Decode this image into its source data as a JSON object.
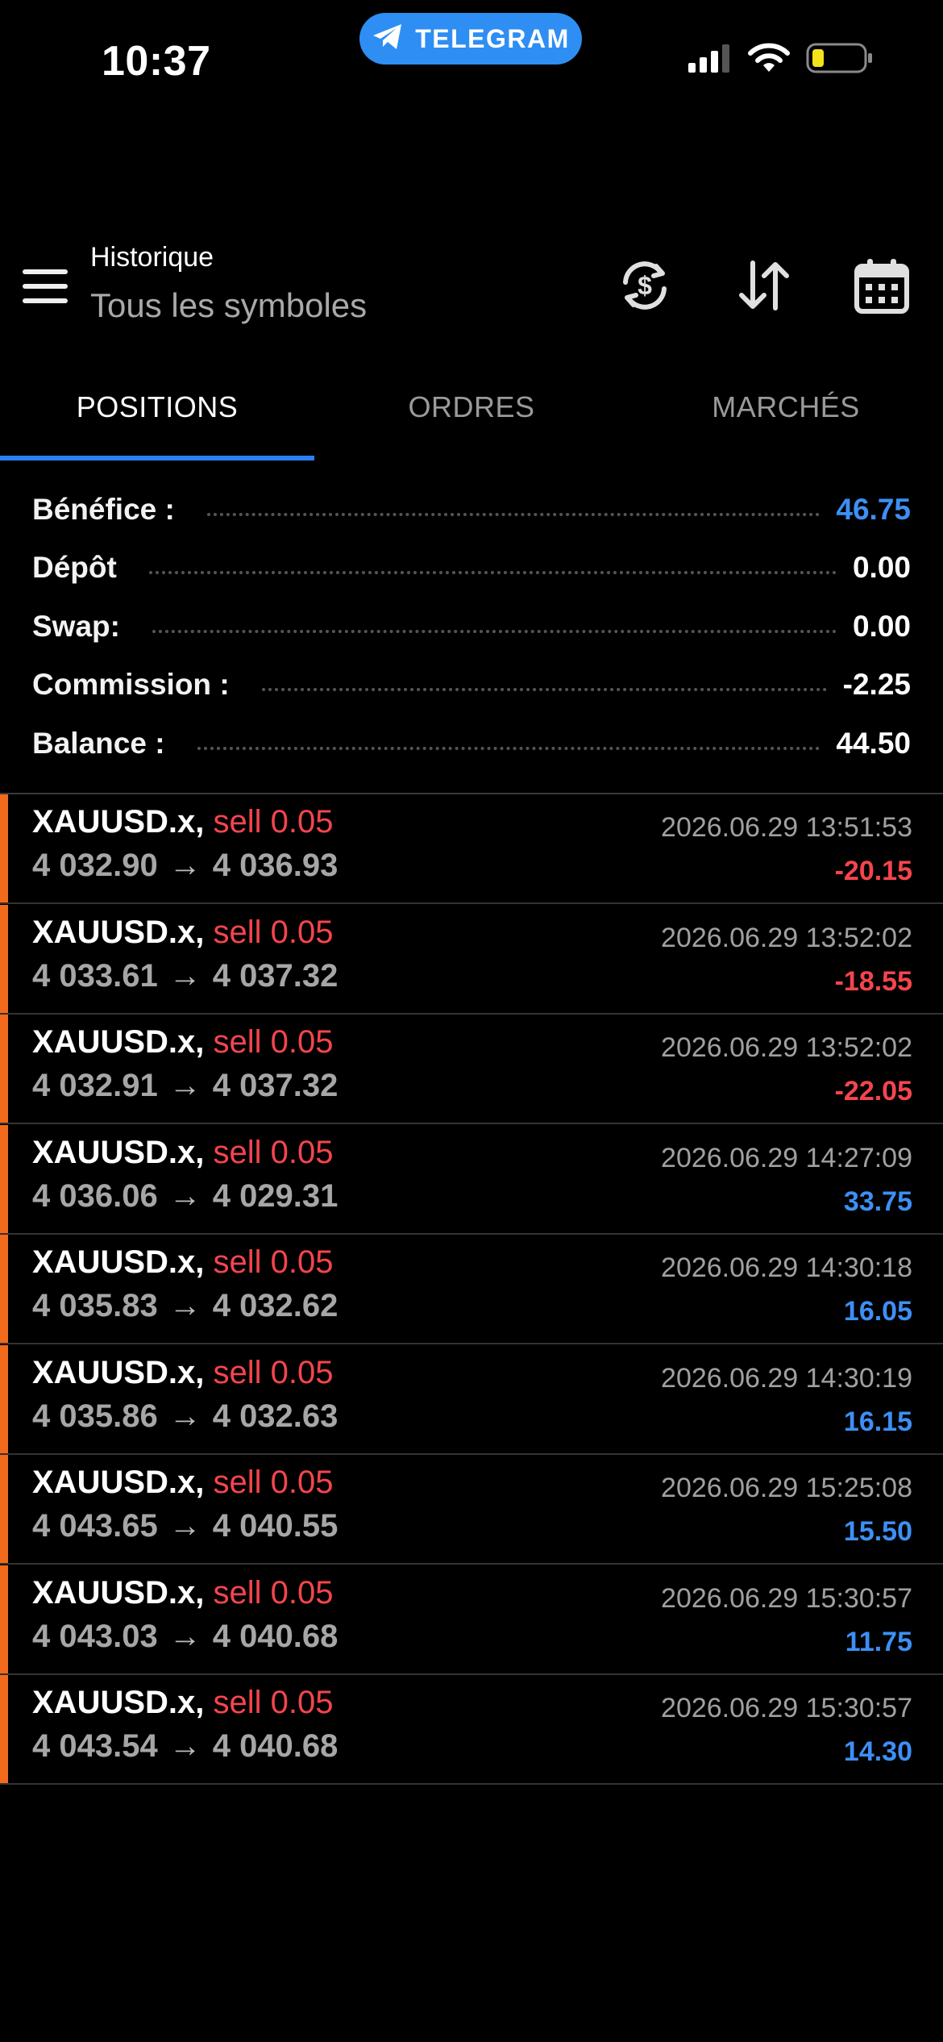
{
  "status_bar": {
    "time": "10:37",
    "telegram_label": "TELEGRAM"
  },
  "header": {
    "title": "Historique",
    "subtitle": "Tous les symboles"
  },
  "tabs": [
    {
      "label": "POSITIONS",
      "active": true
    },
    {
      "label": "ORDRES",
      "active": false
    },
    {
      "label": "MARCHÉS",
      "active": false
    }
  ],
  "summary": [
    {
      "label": "Bénéfice :",
      "value": "46.75",
      "color": "#3d8ff5"
    },
    {
      "label": "Dépôt",
      "value": "0.00",
      "color": "#ffffff"
    },
    {
      "label": "Swap:",
      "value": "0.00",
      "color": "#ffffff"
    },
    {
      "label": "Commission :",
      "value": "-2.25",
      "color": "#ffffff"
    },
    {
      "label": "Balance :",
      "value": "44.50",
      "color": "#ffffff"
    }
  ],
  "trades": [
    {
      "symbol": "XAUUSD.x,",
      "side": "sell 0.05",
      "open": "4 032.90",
      "close": "4 036.93",
      "datetime": "2026.06.29 13:51:53",
      "profit": "-20.15",
      "sign": "neg"
    },
    {
      "symbol": "XAUUSD.x,",
      "side": "sell 0.05",
      "open": "4 033.61",
      "close": "4 037.32",
      "datetime": "2026.06.29 13:52:02",
      "profit": "-18.55",
      "sign": "neg"
    },
    {
      "symbol": "XAUUSD.x,",
      "side": "sell 0.05",
      "open": "4 032.91",
      "close": "4 037.32",
      "datetime": "2026.06.29 13:52:02",
      "profit": "-22.05",
      "sign": "neg"
    },
    {
      "symbol": "XAUUSD.x,",
      "side": "sell 0.05",
      "open": "4 036.06",
      "close": "4 029.31",
      "datetime": "2026.06.29 14:27:09",
      "profit": "33.75",
      "sign": "pos"
    },
    {
      "symbol": "XAUUSD.x,",
      "side": "sell 0.05",
      "open": "4 035.83",
      "close": "4 032.62",
      "datetime": "2026.06.29 14:30:18",
      "profit": "16.05",
      "sign": "pos"
    },
    {
      "symbol": "XAUUSD.x,",
      "side": "sell 0.05",
      "open": "4 035.86",
      "close": "4 032.63",
      "datetime": "2026.06.29 14:30:19",
      "profit": "16.15",
      "sign": "pos"
    },
    {
      "symbol": "XAUUSD.x,",
      "side": "sell 0.05",
      "open": "4 043.65",
      "close": "4 040.55",
      "datetime": "2026.06.29 15:25:08",
      "profit": "15.50",
      "sign": "pos"
    },
    {
      "symbol": "XAUUSD.x,",
      "side": "sell 0.05",
      "open": "4 043.03",
      "close": "4 040.68",
      "datetime": "2026.06.29 15:30:57",
      "profit": "11.75",
      "sign": "pos"
    },
    {
      "symbol": "XAUUSD.x,",
      "side": "sell 0.05",
      "open": "4 043.54",
      "close": "4 040.68",
      "datetime": "2026.06.29 15:30:57",
      "profit": "14.30",
      "sign": "pos"
    }
  ],
  "colors": {
    "accent": "#2a7ff2",
    "loss": "#f4454d",
    "gain": "#3d8ff5",
    "position_bar": "#f26a1b"
  },
  "icons": [
    "telegram-icon",
    "signal-icon",
    "wifi-icon",
    "battery-icon",
    "menu-icon",
    "currency-exchange-icon",
    "sort-icon",
    "calendar-icon"
  ]
}
